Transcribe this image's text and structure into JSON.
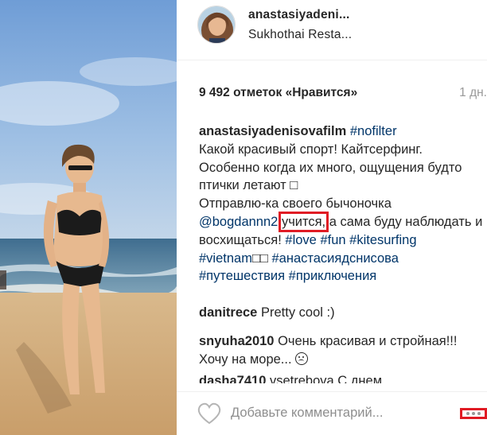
{
  "header": {
    "username": "anastasiyadeni...",
    "location": "Sukhothai Resta..."
  },
  "post": {
    "likes": "9 492 отметок «Нравится»",
    "time": "1 дн.",
    "caption": {
      "author": "anastasiyadenisovafilm",
      "tag_nofilter": "#nofilter",
      "text_1": "Какой красивый спорт! Кайтсерфинг. Особенно когда их много, ощущения будто птички летают",
      "text_2": "Отправлю-ка своего бычоночка",
      "mention": "@bogdannn2",
      "highlight": "учится,",
      "text_3": "а сама буду наблюдать и восхищаться!",
      "tag_love": "#love",
      "tag_fun": "#fun",
      "tag_kitesurfing": "#kitesurfing",
      "tag_vietnam": "#vietnam",
      "tag_anastasiya": "#анастасиядснисова",
      "tag_travel": "#путешествия",
      "tag_adventures": "#приключения"
    }
  },
  "comments": [
    {
      "author": "danitrece",
      "text": "Pretty cool :)"
    },
    {
      "author": "snyuha2010",
      "text": "Очень красивая и стройная!!! Хочу на море..."
    },
    {
      "author": "dasha7410",
      "text": "vsetrebova С днем"
    }
  ],
  "footer": {
    "comment_placeholder": "Добавьте комментарий...",
    "like_icon": "heart-outline-icon",
    "more_icon": "ellipsis-icon"
  },
  "colors": {
    "hashtag": "#003569",
    "muted": "#999999",
    "highlight_box": "#e01b24",
    "text": "#262626"
  }
}
